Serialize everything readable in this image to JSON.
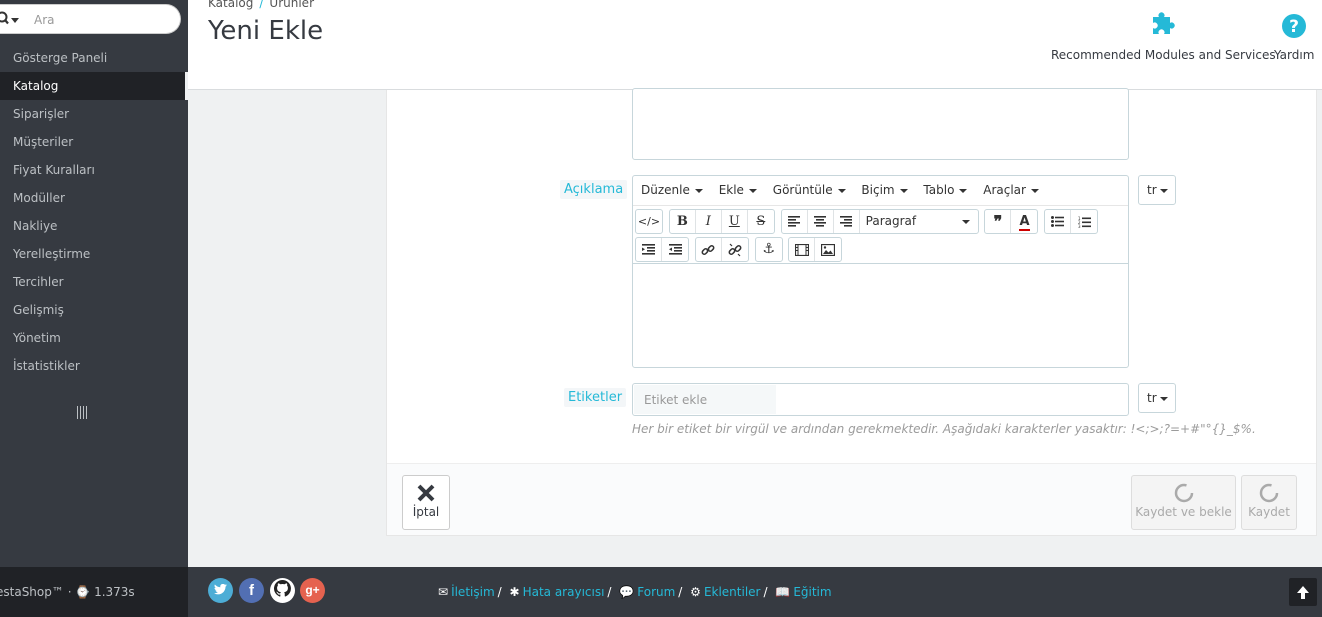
{
  "sidebar": {
    "search_placeholder": "Ara",
    "items": [
      {
        "label": "Gösterge Paneli"
      },
      {
        "label": "Katalog"
      },
      {
        "label": "Siparişler"
      },
      {
        "label": "Müşteriler"
      },
      {
        "label": "Fiyat Kuralları"
      },
      {
        "label": "Modüller"
      },
      {
        "label": "Nakliye"
      },
      {
        "label": "Yerelleştirme"
      },
      {
        "label": "Tercihler"
      },
      {
        "label": "Gelişmiş"
      },
      {
        "label": "Yönetim"
      },
      {
        "label": "İstatistikler"
      }
    ],
    "active_item": "Katalog"
  },
  "header": {
    "breadcrumb": [
      "Katalog",
      "Ürünler"
    ],
    "breadcrumb_sep": "/",
    "title": "Yeni Ekle",
    "toolbar": {
      "modules_label": "Recommended Modules and Services",
      "help_label": "Yardım"
    }
  },
  "form": {
    "description_label": "Açıklama",
    "editor": {
      "menus": [
        "Düzenle",
        "Ekle",
        "Görüntüle",
        "Biçim",
        "Tablo",
        "Araçlar"
      ],
      "format_select": "Paragraf"
    },
    "lang": "tr",
    "tags_label": "Etiketler",
    "tags_placeholder": "Etiket ekle",
    "tags_hint": "Her bir etiket bir virgül ve ardından gerekmektedir. Aşağıdaki karakterler yasaktır: !<;>;?=+#\"°{}_$%."
  },
  "actions": {
    "cancel": "İptal",
    "save_and_stay": "Kaydet ve bekle",
    "save": "Kaydet"
  },
  "footer": {
    "version_text": "estaShop™ · ⌚ 1.373s",
    "links": [
      "İletişim",
      "Hata arayıcısı",
      "Forum",
      "Eklentiler",
      "Eğitim"
    ]
  },
  "colors": {
    "accent": "#25b9d7",
    "sidebar_bg": "#363a41",
    "twitter": "#4dadd6",
    "facebook": "#526fb3",
    "github": "#ffffff",
    "google": "#e5624f"
  }
}
